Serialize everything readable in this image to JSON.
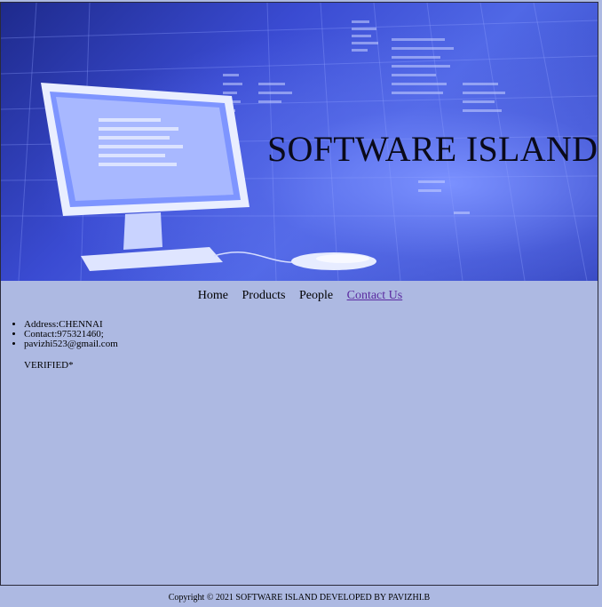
{
  "header": {
    "title": "SOFTWARE ISLAND"
  },
  "nav": {
    "items": [
      {
        "label": "Home"
      },
      {
        "label": "Products"
      },
      {
        "label": "People"
      },
      {
        "label": "Contact Us"
      }
    ]
  },
  "contact": {
    "address": "Address:CHENNAI",
    "phone": "Contact:975321460;",
    "email": "pavizhi523@gmail.com",
    "verified": "VERIFIED*"
  },
  "footer": {
    "text": "Copyright © 2021 SOFTWARE ISLAND DEVELOPED BY PAVIZHI.B"
  },
  "colors": {
    "page_background": "#adb9e2",
    "banner_blue": "#3a4bd2",
    "active_link": "#5a2aa0"
  }
}
